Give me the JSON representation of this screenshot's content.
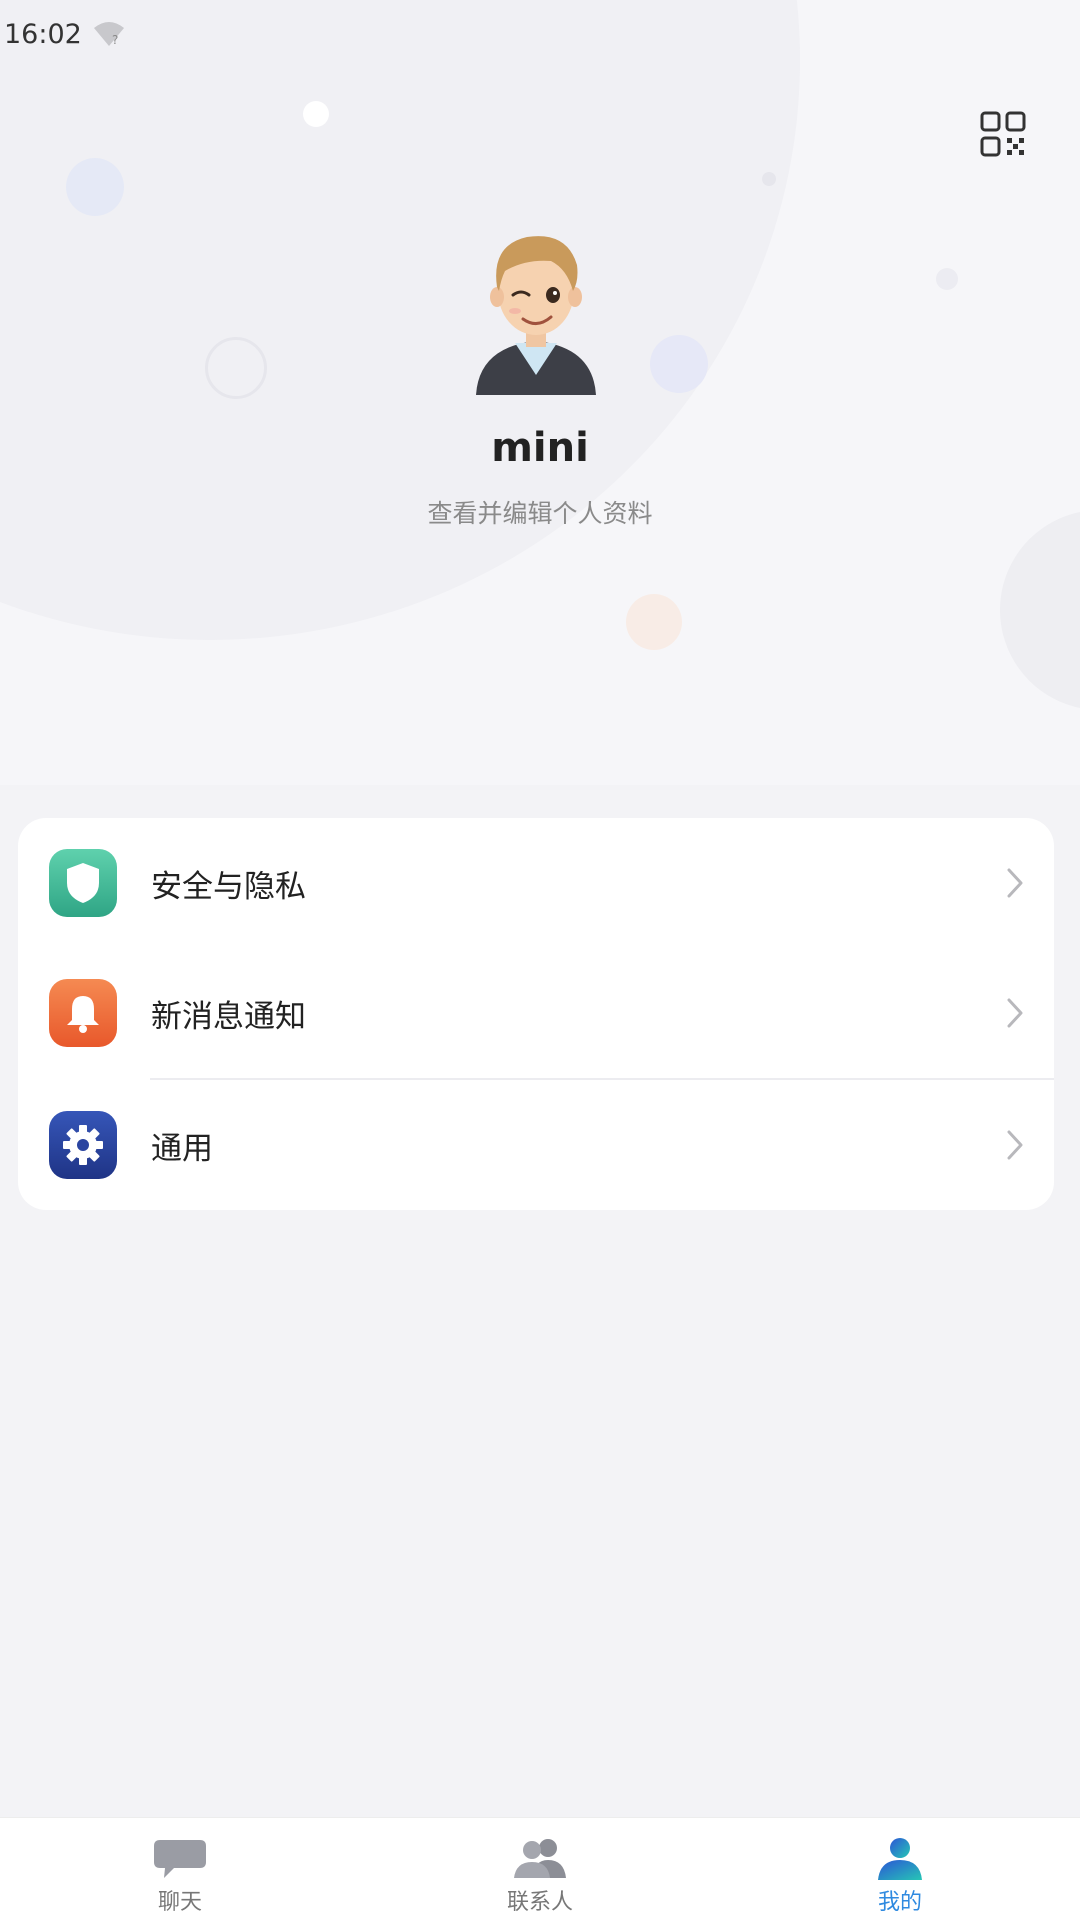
{
  "status_bar": {
    "time": "16:02"
  },
  "profile": {
    "username": "mini",
    "subtitle": "查看并编辑个人资料"
  },
  "menu": {
    "items": [
      {
        "label": "安全与隐私",
        "icon": "shield-icon",
        "color": "#3fbf9e"
      },
      {
        "label": "新消息通知",
        "icon": "bell-icon",
        "color": "#ee6a38"
      },
      {
        "label": "通用",
        "icon": "gear-icon",
        "color": "#2c4aa8"
      }
    ]
  },
  "tabbar": {
    "tabs": [
      {
        "label": "聊天",
        "icon": "chat-icon",
        "active": false
      },
      {
        "label": "联系人",
        "icon": "contacts-icon",
        "active": false
      },
      {
        "label": "我的",
        "icon": "profile-icon",
        "active": true
      }
    ]
  },
  "colors": {
    "accent": "#2f8ae0",
    "background": "#f3f3f6"
  }
}
